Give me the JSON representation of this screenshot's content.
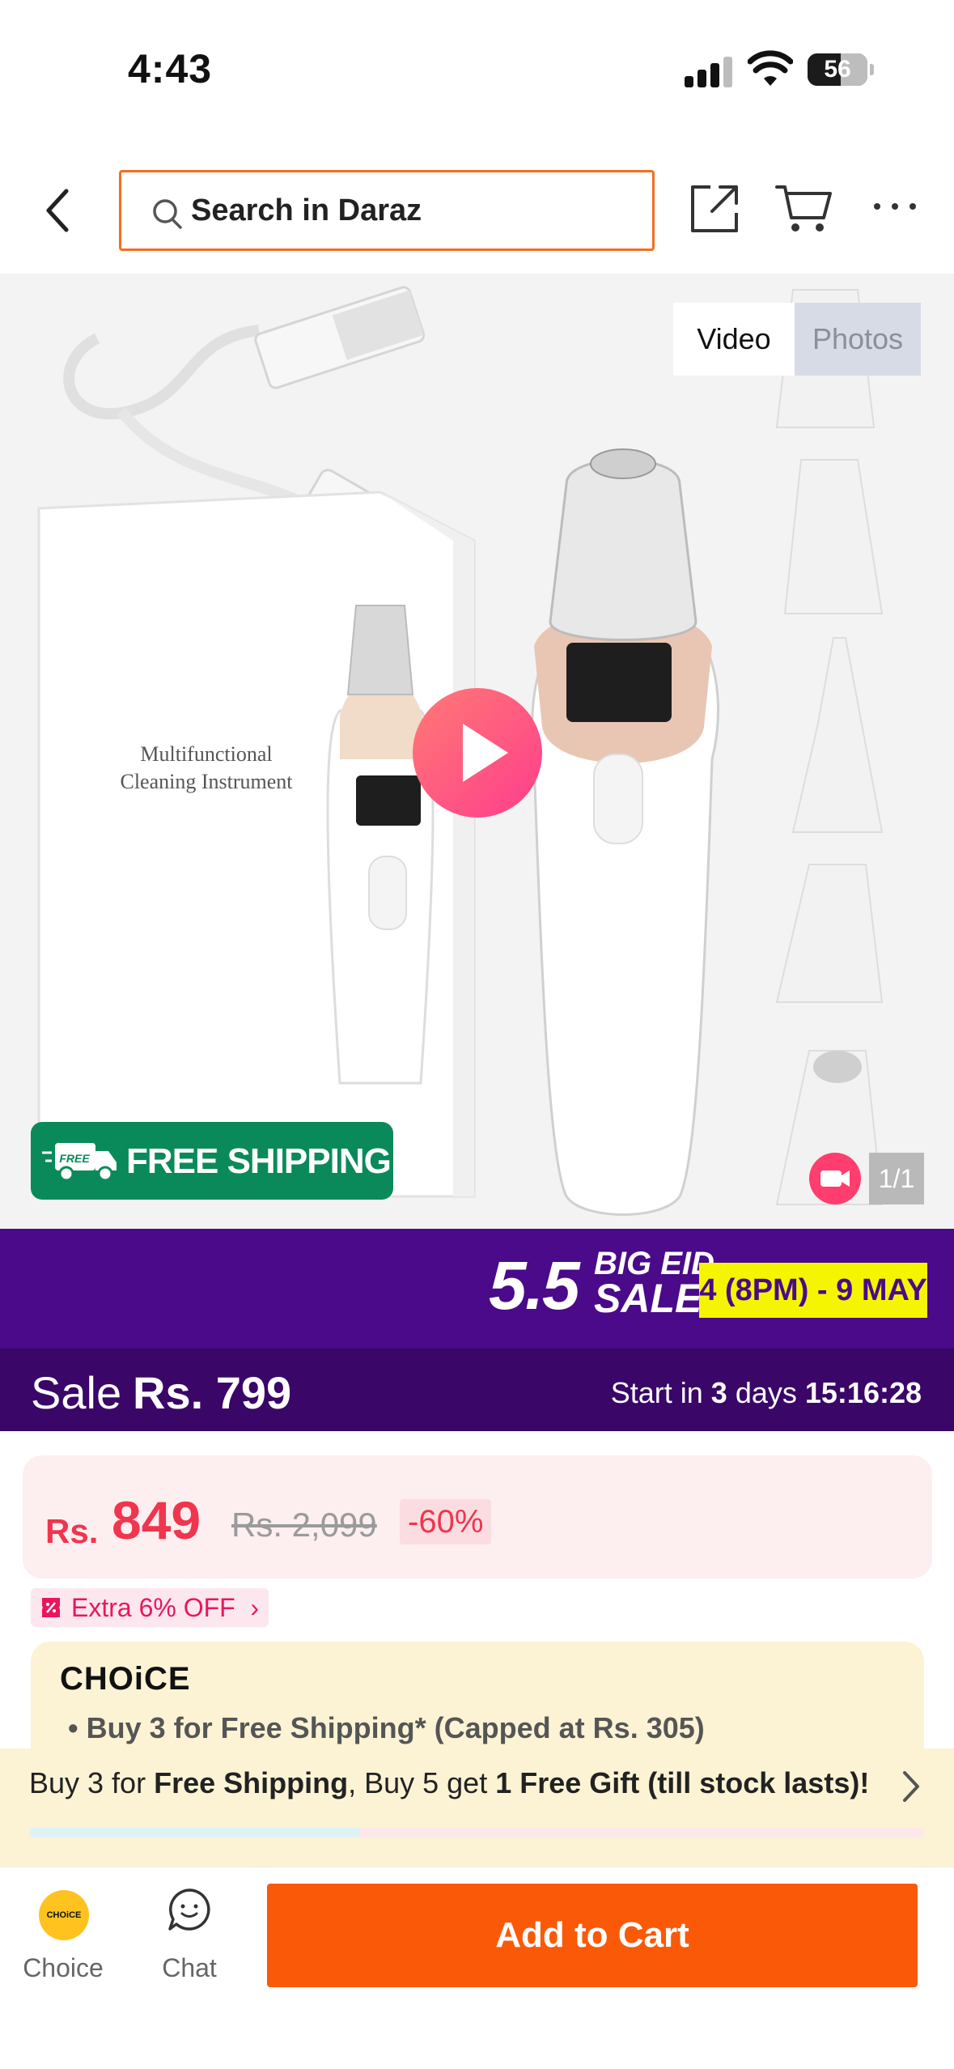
{
  "status_bar": {
    "time": "4:43",
    "battery_level": "56",
    "battery_percent": 56,
    "icons": [
      "signal-icon",
      "wifi-icon",
      "battery-icon"
    ]
  },
  "topnav": {
    "search_placeholder": "Search in Daraz",
    "icons": [
      "back-icon",
      "search-icon",
      "share-icon",
      "cart-icon",
      "more-icon"
    ],
    "accent_color": "#f36f21"
  },
  "gallery": {
    "box_text_line1": "Multifunctional",
    "box_text_line2": "Cleaning Instrument",
    "tab_video": "Video",
    "tab_photos": "Photos",
    "free_shipping": "FREE SHIPPING",
    "free_shipping_badge": "FREE",
    "counter": "1/1"
  },
  "campaign": {
    "event_number": "5.5",
    "event_line1": "BIG EID",
    "event_line2": "SALE",
    "dates": "4 (8PM) - 9 MAY",
    "bg_color": "#4a0a8a"
  },
  "sale": {
    "label": "Sale",
    "price": "Rs. 799",
    "start_prefix": "Start in",
    "start_days": "3",
    "start_days_unit": "days",
    "start_time": "15:16:28"
  },
  "price": {
    "currency": "Rs.",
    "current": "849",
    "original": "Rs. 2,099",
    "discount": "-60%",
    "color": "#f0354e"
  },
  "extra_offer": {
    "label": "Extra 6% OFF",
    "chevron": "›"
  },
  "choice": {
    "logo": "CHOiCE",
    "bullet": "•  Buy 3 for  Free Shipping* (Capped at Rs. 305)"
  },
  "bundle": {
    "t1": "Buy 3 for ",
    "b1": "Free Shipping",
    "t2": ", Buy 5 get ",
    "b2": "1 Free Gift (till stock lasts)!",
    "progress_fraction": 0.37
  },
  "bottom_bar": {
    "choice_badge": "CHOiCE",
    "choice_label": "Choice",
    "chat_label": "Chat",
    "add_to_cart": "Add to Cart",
    "button_color": "#fa5a08"
  }
}
